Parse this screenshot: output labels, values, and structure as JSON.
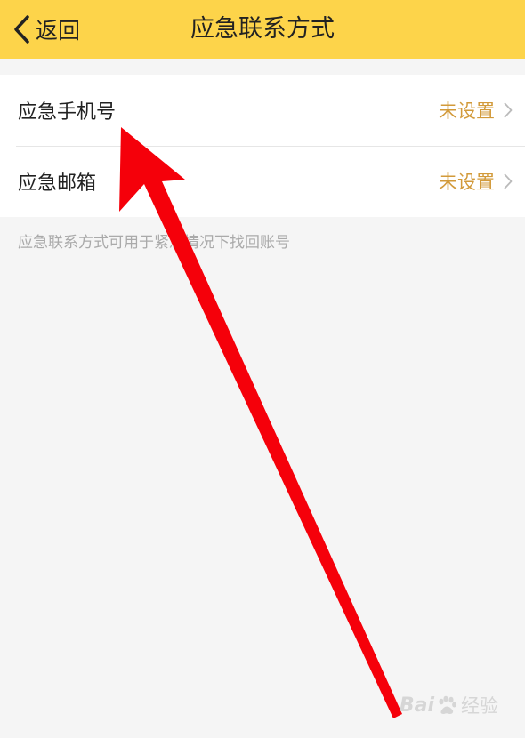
{
  "navbar": {
    "back_label": "返回",
    "title": "应急联系方式"
  },
  "settings": [
    {
      "label": "应急手机号",
      "value": "未设置"
    },
    {
      "label": "应急邮箱",
      "value": "未设置"
    }
  ],
  "hint": "应急联系方式可用于紧急情况下找回账号",
  "watermark": {
    "brand": "Bai",
    "sub": "经验"
  },
  "colors": {
    "navbar_bg": "#fdd44a",
    "value_text": "#d29a3a",
    "annotation_arrow": "#f5000a"
  }
}
